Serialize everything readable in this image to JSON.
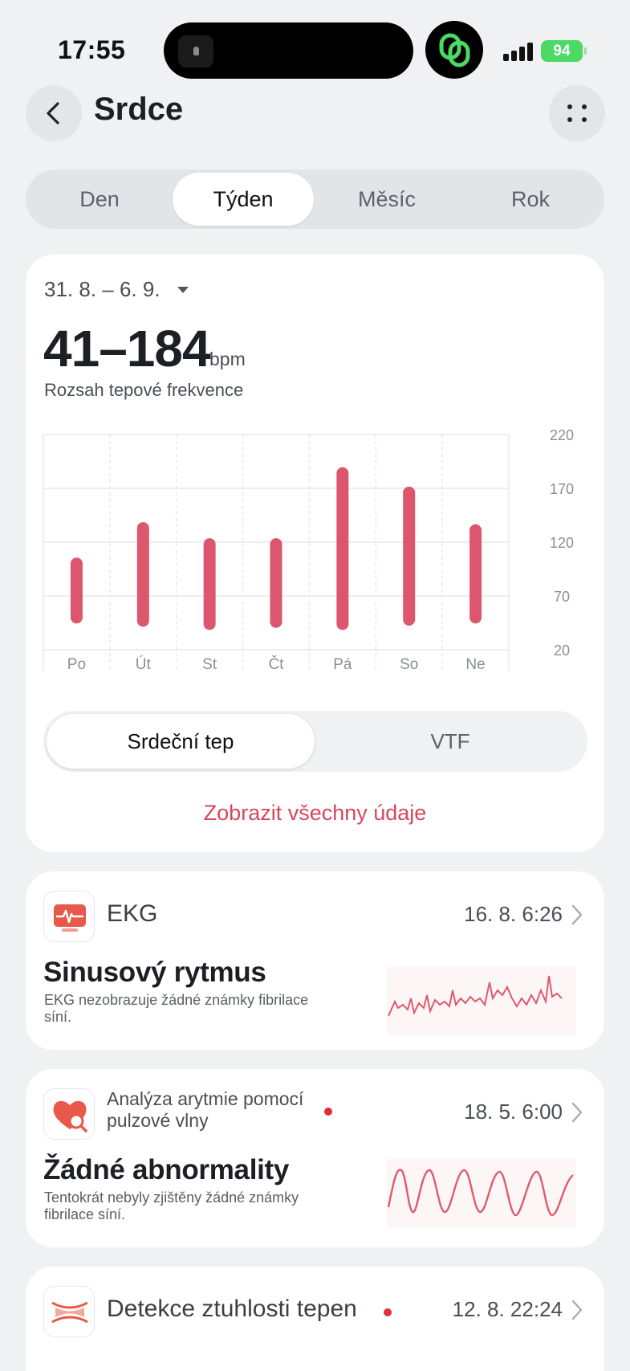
{
  "status_bar": {
    "time": "17:55",
    "battery": "94",
    "battery_color": "#4cd964"
  },
  "nav": {
    "back_icon": "chevron-left-icon",
    "title": "Srdce",
    "more_icon": "grid-dots-icon"
  },
  "periods": {
    "items": [
      "Den",
      "Týden",
      "Měsíc",
      "Rok"
    ],
    "selected": "Týden"
  },
  "range_card": {
    "date_range": "31. 8. – 6. 9.",
    "value": "41–184",
    "unit": "bpm",
    "label": "Rozsah tepové frekvence"
  },
  "chart_data": {
    "type": "bar",
    "subtype": "range",
    "categories": [
      "Po",
      "Út",
      "St",
      "Čt",
      "Pá",
      "So",
      "Ne"
    ],
    "series": [
      {
        "low": [
          50,
          47,
          44,
          46,
          44,
          48,
          50
        ],
        "high": [
          100,
          133,
          118,
          118,
          184,
          166,
          131
        ]
      }
    ],
    "y_ticks": [
      220,
      170,
      120,
      70,
      20
    ],
    "ylim": [
      20,
      220
    ],
    "bar_color": "#dc566d",
    "grid": true,
    "y_axis_side": "right"
  },
  "metric_tabs": {
    "items": [
      "Srdeční tep",
      "VTF"
    ],
    "selected": "Srdeční tep"
  },
  "show_all_link": "Zobrazit všechny údaje",
  "accent_color": "#d8465e",
  "features": [
    {
      "icon": "ekg-monitor-icon",
      "title": "EKG",
      "date": "16. 8. 6:26",
      "result": "Sinusový rytmus",
      "description": "EKG nezobrazuje žádné známky fibrilace síní.",
      "new_dot": false
    },
    {
      "icon": "heart-search-icon",
      "title": "Analýza arytmie pomocí pulzové vlny",
      "date": "18. 5. 6:00",
      "result": "Žádné abnormality",
      "description": "Tentokrát nebyly zjištěny žádné známky fibrilace síní.",
      "new_dot": true
    },
    {
      "icon": "artery-icon",
      "title": "Detekce ztuhlosti tepen",
      "date": "12. 8. 22:24",
      "new_dot": true
    }
  ]
}
